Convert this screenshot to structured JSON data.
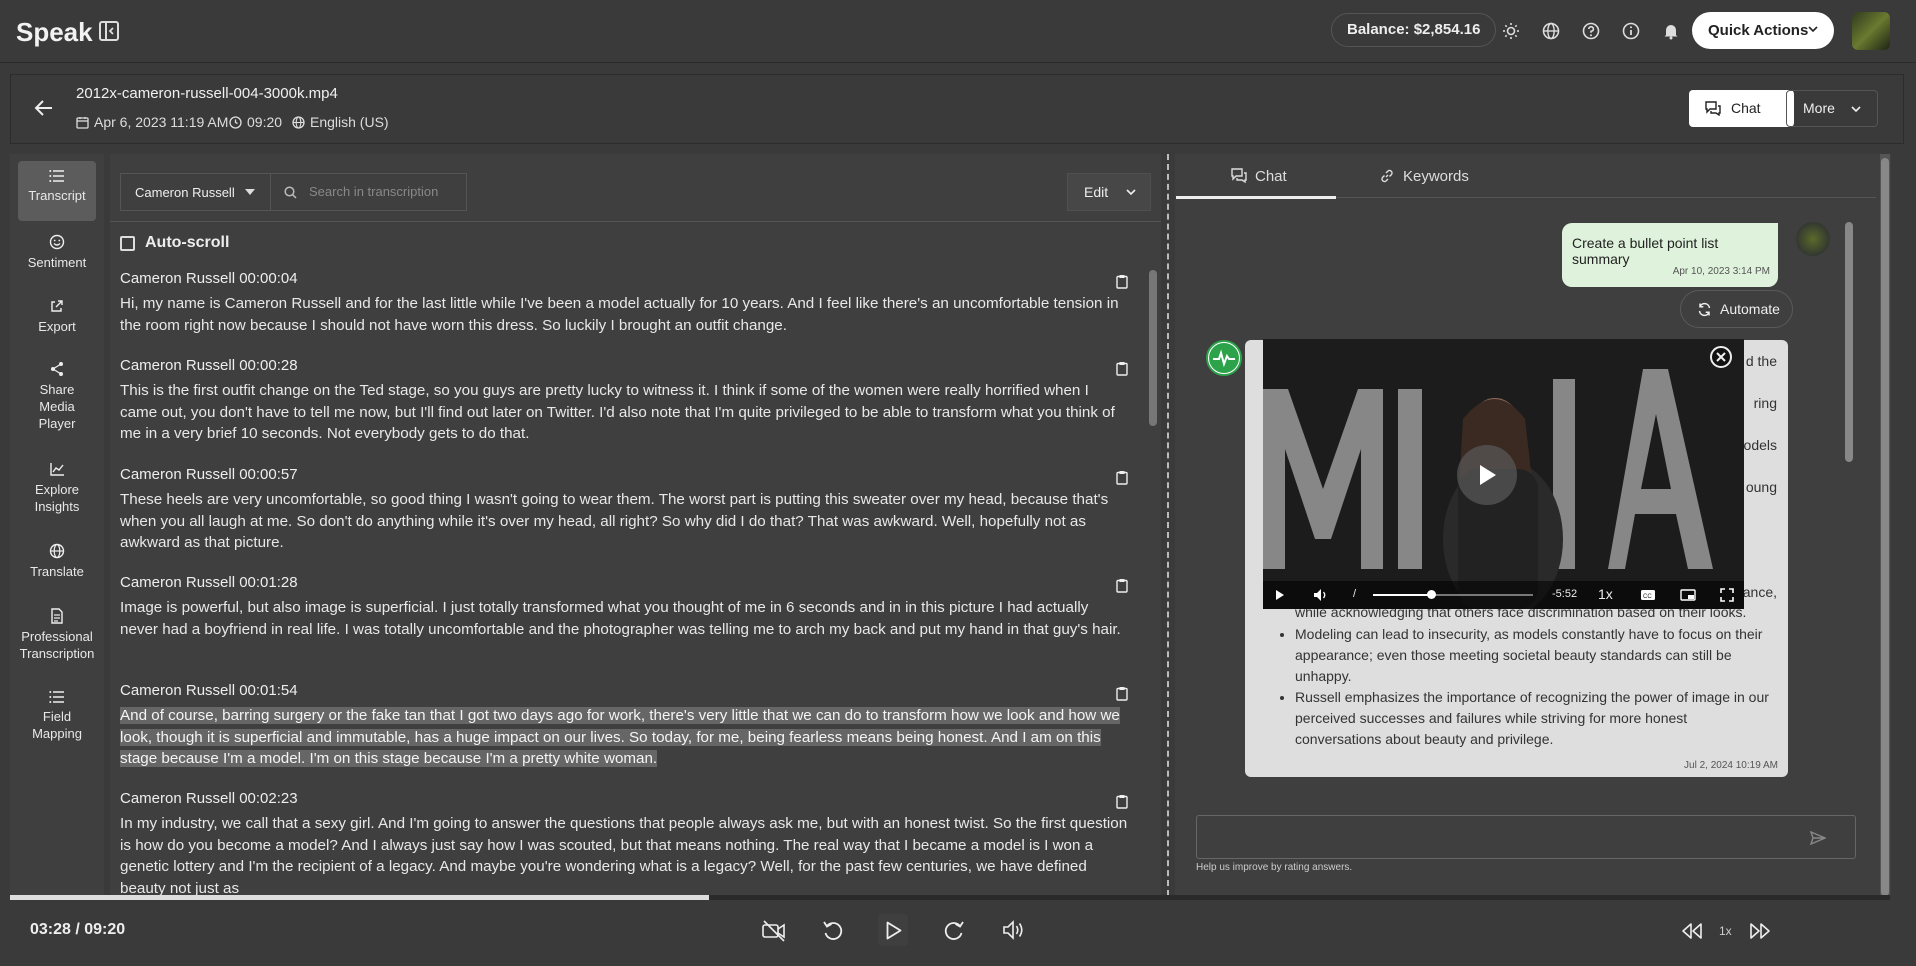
{
  "app": {
    "logo": "Speak",
    "balance": "Balance: $2,854.16",
    "quick_actions": "Quick Actions"
  },
  "file": {
    "name": "2012x-cameron-russell-004-3000k.mp4",
    "date": "Apr 6, 2023 11:19 AM",
    "duration": "09:20",
    "language": "English (US)"
  },
  "header_buttons": {
    "chat": "Chat",
    "more": "More"
  },
  "nav": [
    {
      "label": "Transcript",
      "icon": "list-icon"
    },
    {
      "label": "Sentiment",
      "icon": "smile-icon"
    },
    {
      "label": "Export",
      "icon": "export-icon"
    },
    {
      "label": "Share Media Player",
      "icon": "share-icon"
    },
    {
      "label": "Explore Insights",
      "icon": "chart-icon"
    },
    {
      "label": "Translate",
      "icon": "globe-icon"
    },
    {
      "label": "Professional Transcription",
      "icon": "document-icon"
    },
    {
      "label": "Field Mapping",
      "icon": "list-icon"
    }
  ],
  "transcript": {
    "speaker_filter": "Cameron Russell",
    "search_placeholder": "Search in transcription",
    "edit_label": "Edit",
    "autoscroll_label": "Auto-scroll",
    "segments": [
      {
        "header": "Cameron Russell 00:00:04",
        "text": "Hi, my name is Cameron Russell and for the last little while I've been a model actually for 10 years. And I feel like there's an uncomfortable tension in the room right now because I should not have worn this dress. So luckily I brought an outfit change."
      },
      {
        "header": "Cameron Russell 00:00:28",
        "text": "This is the first outfit change on the Ted stage, so you guys are pretty lucky to witness it. I think if some of the women were really horrified when I came out, you don't have to tell me now, but I'll find out later on Twitter. I'd also note that I'm quite privileged to be able to transform what you think of me in a very brief 10 seconds. Not everybody gets to do that."
      },
      {
        "header": "Cameron Russell 00:00:57",
        "text": "These heels are very uncomfortable, so good thing I wasn't going to wear them. The worst part is putting this sweater over my head, because that's when you all laugh at me. So don't do anything while it's over my head, all right? So why did I do that? That was awkward. Well, hopefully not as awkward as that picture."
      },
      {
        "header": "Cameron Russell 00:01:28",
        "text": "Image is powerful, but also image is superficial. I just totally transformed what you thought of me in 6 seconds and in in this picture I had actually never had a boyfriend in real life. I was totally uncomfortable and the photographer was telling me to arch my back and put my hand in that guy's hair."
      },
      {
        "header": "Cameron Russell 00:01:54",
        "text": " And of course, barring surgery or the fake tan that I got two days ago for work, there's very little that we can do to transform how we look and how we look, though it is superficial and immutable, has a huge impact on our lives. So today, for me, being fearless means being honest. And I am on this stage because I'm a model. I'm on this stage because I'm a pretty white woman."
      },
      {
        "header": "Cameron Russell 00:02:23",
        "text": "In my industry, we call that a sexy girl. And I'm going to answer the questions that people always ask me, but with an honest twist. So the first question is how do you become a model? And I always just say how I was scouted, but that means nothing. The real way that I became a model is I won a genetic lottery and I'm the recipient of a legacy. And maybe you're wondering what is a legacy? Well, for the past few centuries, we have defined beauty not just as"
      }
    ]
  },
  "chat": {
    "tabs": [
      "Chat",
      "Keywords"
    ],
    "user_message": "Create a bullet point list summary",
    "user_time": "Apr 10, 2023 3:14 PM",
    "automate": "Automate",
    "bot_fragments": [
      "d the",
      "ring",
      "odels",
      "oung",
      "ance,"
    ],
    "bot_bullets": [
      "while acknowledging that others face discrimination based on their looks.",
      "Modeling can lead to insecurity, as models constantly have to focus on their appearance; even those meeting societal beauty standards can still be unhappy.",
      "Russell emphasizes the importance of recognizing the power of image in our perceived successes and failures while striving for more honest conversations about beauty and privilege."
    ],
    "bot_time": "Jul 2, 2024 10:19 AM",
    "help_text": "Help us improve by rating answers."
  },
  "video": {
    "remaining": "-5:52",
    "speed": "1x",
    "separator": "/",
    "progress": 0.36
  },
  "player": {
    "time": "03:28 / 09:20",
    "progress": 0.372,
    "speed": "1x"
  }
}
